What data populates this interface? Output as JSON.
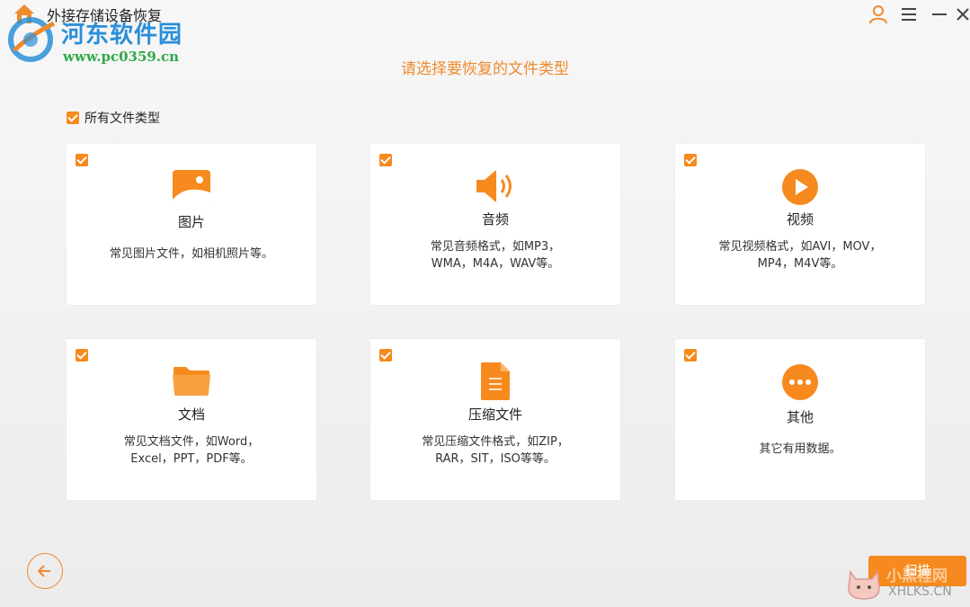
{
  "window": {
    "title": "外接存储设备恢复"
  },
  "watermark_top": {
    "name": "河东软件园",
    "url": "www.pc0359.cn"
  },
  "heading": "请选择要恢复的文件类型",
  "all_types": {
    "label": "所有文件类型",
    "checked": true
  },
  "cards": [
    {
      "title": "图片",
      "desc": "常见图片文件，如相机照片等。",
      "checked": true,
      "icon": "image-icon"
    },
    {
      "title": "音频",
      "desc": "常见音频格式，如MP3，\nWMA，M4A，WAV等。",
      "checked": true,
      "icon": "speaker-icon"
    },
    {
      "title": "视频",
      "desc": "常见视频格式，如AVI，MOV，\nMP4，M4V等。",
      "checked": true,
      "icon": "play-icon"
    },
    {
      "title": "文档",
      "desc": "常见文档文件，如Word，\nExcel，PPT，PDF等。",
      "checked": true,
      "icon": "folder-icon"
    },
    {
      "title": "压缩文件",
      "desc": "常见压缩文件格式，如ZIP，\nRAR，SIT，ISO等等。",
      "checked": true,
      "icon": "archive-file-icon"
    },
    {
      "title": "其他",
      "desc": "其它有用数据。",
      "checked": true,
      "icon": "more-icon"
    }
  ],
  "buttons": {
    "scan": "扫描"
  },
  "watermark_bottom": {
    "text": "小黑裡网",
    "url": "XHLKS.CN"
  },
  "colors": {
    "accent": "#f68a1e",
    "heading": "#f08a2c"
  }
}
